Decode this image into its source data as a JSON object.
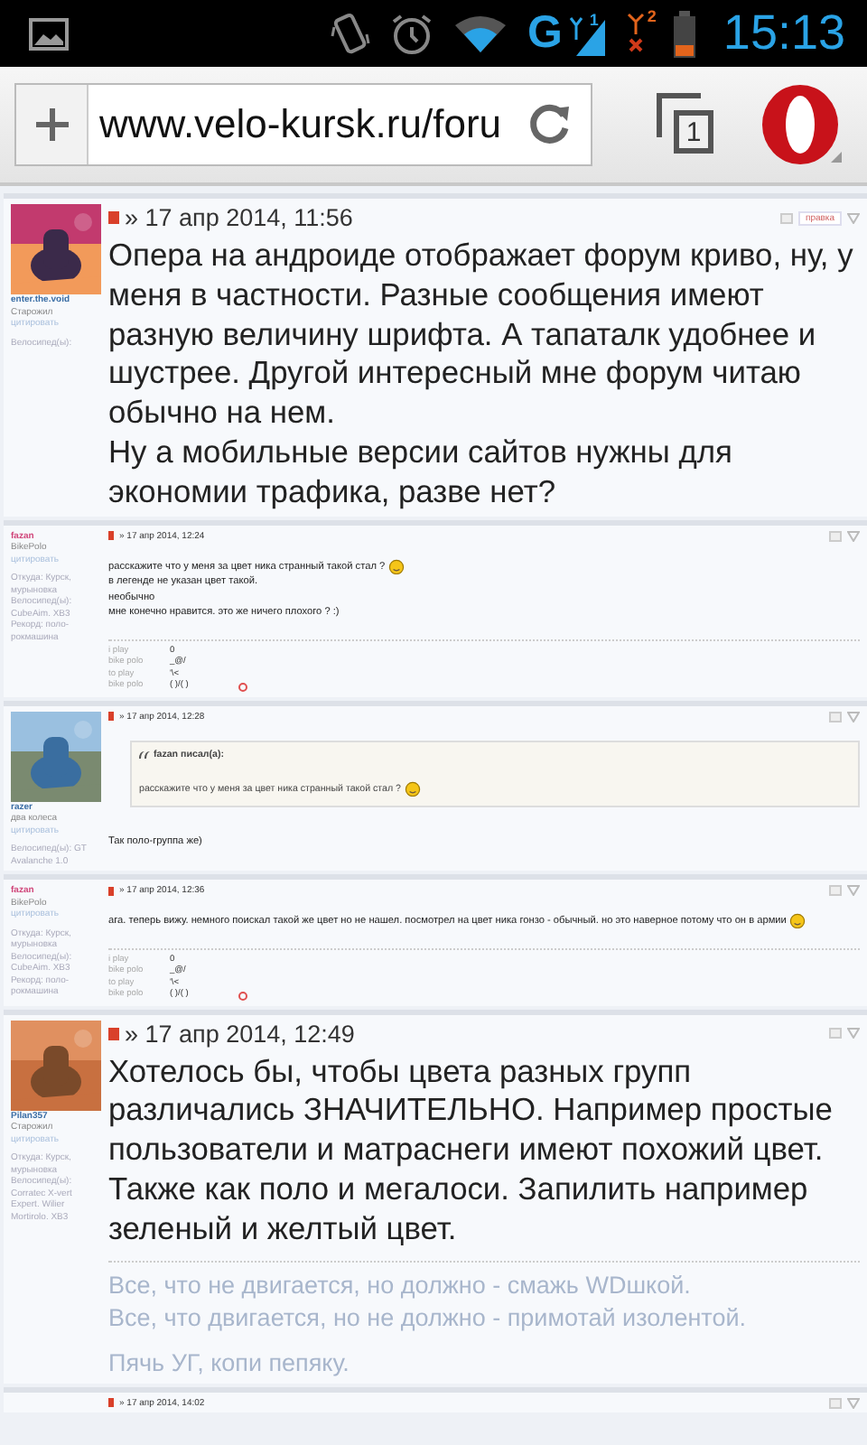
{
  "status_bar": {
    "network_letter": "G",
    "sim_1": "1",
    "sim_2": "2",
    "time": "15:13"
  },
  "browser": {
    "url": "www.velo-kursk.ru/foru",
    "tab_count": "1"
  },
  "posts": [
    {
      "kind": "large",
      "author": "enter.the.void",
      "color": "#3b6ea5",
      "rank": "Старожил",
      "quote_link": "цитировать",
      "profile": [
        "Велосипед(ы):"
      ],
      "avatar": {
        "kind": "picture"
      },
      "date": "» 17 апр 2014, 11:56",
      "edit_button": "правка",
      "body": [
        {
          "text": "Опера на андроиде отображает форум криво, ну, у меня в частности. Разные сообщения имеют разную величину шрифта. А тапаталк удобнее и шустрее. Другой интересный мне форум читаю обычно на нем.",
          "smiley": false
        },
        {
          "text": "Ну а мобильные версии сайтов нужны для экономии трафика, разве нет?",
          "smiley": false
        }
      ]
    },
    {
      "kind": "small",
      "author": "fazan",
      "color": "#d0467a",
      "rank": "BikePolo",
      "quote_link": "цитировать",
      "profile": [
        "Откуда: Курск, мурыновка",
        "Велосипед(ы): CubeAim. XB3",
        "Рекорд: поло-рокмашина"
      ],
      "date": "» 17 апр 2014, 12:24",
      "body": [
        {
          "text": "расскажите что у меня за цвет ника странный такой стал ?",
          "smiley": true
        },
        {
          "text": "в легенде не указан цвет такой.",
          "smiley": false
        },
        {
          "text": "необычно",
          "smiley": false
        },
        {
          "text": "мне конечно нравится. это же ничего плохого ? :)",
          "smiley": false
        }
      ],
      "signature_table": [
        [
          "i play",
          "0"
        ],
        [
          "bike polo",
          "_@/"
        ],
        [
          "to play",
          "'\\<"
        ],
        [
          "bike polo",
          "( )/( )"
        ]
      ]
    },
    {
      "kind": "small",
      "author": "razer",
      "color": "#3b6ea5",
      "rank": "два колеса",
      "quote_link": "цитировать",
      "profile": [
        "Велосипед(ы): GT Avalanche 1.0"
      ],
      "avatar": {
        "kind": "picture"
      },
      "date": "» 17 апр 2014, 12:28",
      "quote": {
        "author": "fazan писал(а):",
        "text": "расскажите что у меня за цвет ника странный такой стал ?"
      },
      "body": [
        {
          "text": "Так поло-группа же)",
          "smiley": false
        }
      ]
    },
    {
      "kind": "small",
      "author": "fazan",
      "color": "#d0467a",
      "rank": "BikePolo",
      "quote_link": "цитировать",
      "profile": [
        "Откуда: Курск, мурыновка",
        "Велосипед(ы): CubeAim. XB3",
        "Рекорд: поло-рокмашина"
      ],
      "date": "» 17 апр 2014, 12:36",
      "body": [
        {
          "text": "ага. теперь вижу. немного поискал такой же цвет но не нашел. посмотрел на цвет ника гонзо - обычный. но это наверное потому что он в армии",
          "smiley": true
        }
      ],
      "signature_table": [
        [
          "i play",
          "0"
        ],
        [
          "bike polo",
          "_@/"
        ],
        [
          "to play",
          "'\\<"
        ],
        [
          "bike polo",
          "( )/( )"
        ]
      ]
    },
    {
      "kind": "large",
      "author": "Pilan357",
      "color": "#3b6ea5",
      "rank": "Старожил",
      "quote_link": "цитировать",
      "profile": [
        "Откуда: Курск, мурыновка",
        "Велосипед(ы): Corratec X-vert Expert. Wilier Mortirolo. XB3"
      ],
      "avatar": {
        "kind": "picture"
      },
      "date": "» 17 апр 2014, 12:49",
      "body": [
        {
          "text": "Хотелось бы, чтобы цвета разных групп различались ЗНАЧИТЕЛЬНО. Например простые пользователи и матраснеги имеют похожий цвет. Также как поло и мегалоси. Запилить например зеленый и желтый цвет.",
          "smiley": false
        }
      ],
      "signature_lines": [
        "Все, что не двигается, но должно - смажь WDшкой.",
        "Все, что двигается, но не должно - примотай изолентой.",
        "Пячь УГ, копи пепяку."
      ]
    },
    {
      "kind": "small",
      "date": "» 17 апр 2014, 14:02"
    }
  ]
}
